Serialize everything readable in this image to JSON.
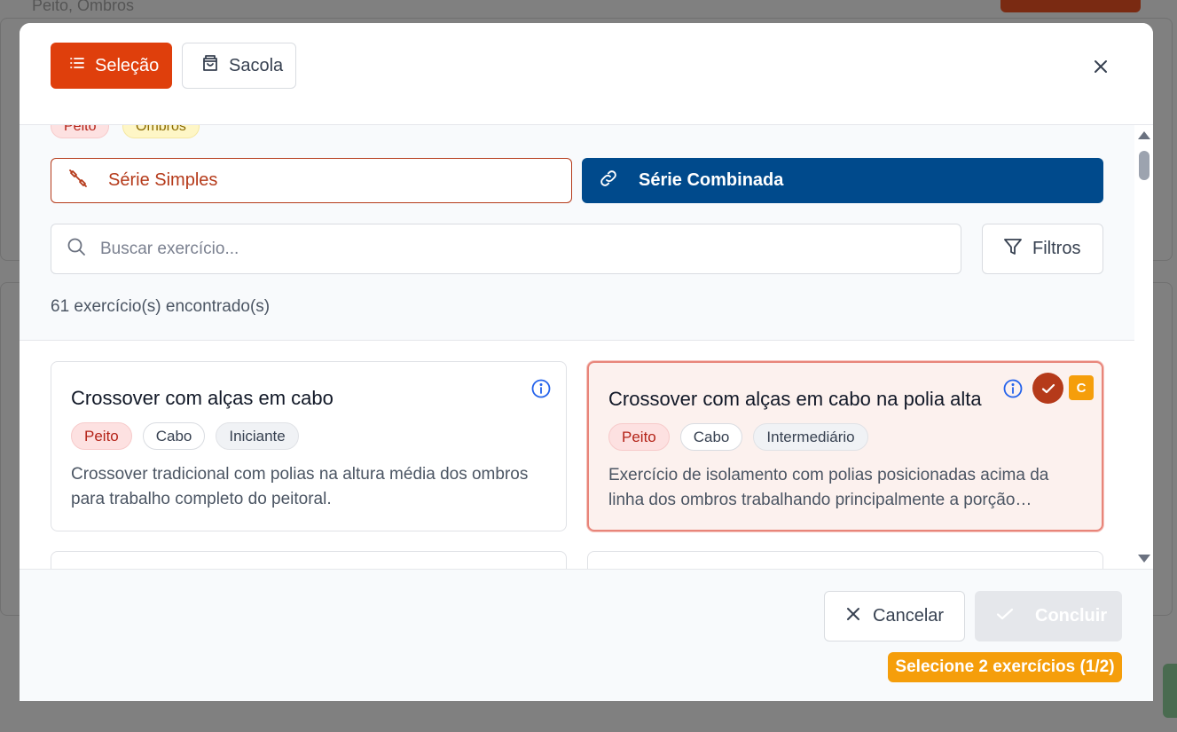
{
  "background": {
    "partial_text": "Peito, Ombros"
  },
  "header": {
    "tabs": [
      {
        "label": "Seleção",
        "icon": "list-icon",
        "active": true
      },
      {
        "label": "Sacola",
        "icon": "shopping-bag-icon",
        "active": false
      }
    ],
    "close_icon": "close-icon"
  },
  "filters": {
    "partial_chips": [
      "Peito",
      "Ombros"
    ],
    "modes": [
      {
        "label": "Série Simples",
        "icon": "dumbbell-icon",
        "active": false
      },
      {
        "label": "Série Combinada",
        "icon": "link-icon",
        "active": true
      }
    ],
    "search": {
      "placeholder": "Buscar exercício...",
      "value": ""
    },
    "filter_button": "Filtros",
    "result_count": "61 exercício(s) encontrado(s)"
  },
  "exercises": [
    {
      "title": "Crossover com alças em cabo",
      "tags": [
        "Peito",
        "Cabo",
        "Iniciante"
      ],
      "description": "Crossover tradicional com polias na altura média dos ombros para trabalho completo do peitoral.",
      "selected": false
    },
    {
      "title": "Crossover com alças em cabo na polia alta",
      "tags": [
        "Peito",
        "Cabo",
        "Intermediário"
      ],
      "description": "Exercício de isolamento com polias posicionadas acima da linha dos ombros trabalhando principalmente a porção…",
      "selected": true,
      "badge": "C"
    }
  ],
  "footer": {
    "cancel_label": "Cancelar",
    "done_label": "Concluir",
    "warning": "Selecione 2 exercícios (1/2)"
  },
  "colors": {
    "primary": "#df3f0c",
    "secondary": "#004a8c",
    "warning": "#f59e0b"
  }
}
